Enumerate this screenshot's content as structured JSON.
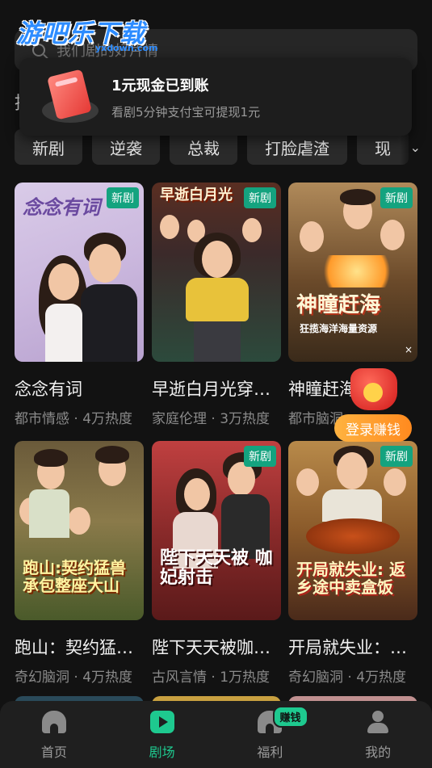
{
  "watermark": {
    "logo": "游吧乐下载",
    "sub": "yxdown.com"
  },
  "search": {
    "placeholder": "我们剧的好片情"
  },
  "toast": {
    "title": "1元现金已到账",
    "subtitle": "看剧5分钟支付宝可提现1元"
  },
  "header": {
    "stray_char": "推"
  },
  "categories": [
    "新剧",
    "逆袭",
    "总裁",
    "打脸虐渣",
    "现"
  ],
  "cards": [
    {
      "badge": "新剧",
      "poster_text": "念念有词",
      "title": "念念有词",
      "meta": "都市情感 · 4万热度"
    },
    {
      "badge": "新剧",
      "poster_text": "早逝白月光",
      "title": "早逝白月光穿…",
      "meta": "家庭伦理 · 3万热度"
    },
    {
      "badge": "新剧",
      "poster_text": "神瞳赶海",
      "poster_sub": "狂揽海洋海量资源",
      "title": "神瞳赶海",
      "meta": "都市脑洞"
    },
    {
      "badge": "",
      "poster_text": "跑山:契约猛兽 承包整座大山",
      "title": "跑山：契约猛…",
      "meta": "奇幻脑洞 · 4万热度"
    },
    {
      "badge": "新剧",
      "poster_text": "陛下天天被 咖妃射击",
      "title": "陛下天天被咖…",
      "meta": "古风言情 · 1万热度"
    },
    {
      "badge": "新剧",
      "poster_text": "开局就失业: 返乡途中卖盒饭",
      "title": "开局就失业：…",
      "meta": "奇幻脑洞 · 4万热度"
    }
  ],
  "floating": {
    "login_label": "登录赚钱"
  },
  "nav": {
    "items": [
      {
        "label": "首页",
        "icon": "home-icon"
      },
      {
        "label": "剧场",
        "icon": "theater-play-icon",
        "active": true
      },
      {
        "label": "福利",
        "icon": "welfare-icon",
        "badge": "赚钱"
      },
      {
        "label": "我的",
        "icon": "profile-icon"
      }
    ]
  },
  "colors": {
    "accent": "#1ec98f",
    "badge_green": "#14a37f",
    "login_orange": "#ff8a1f",
    "background": "#121212"
  }
}
